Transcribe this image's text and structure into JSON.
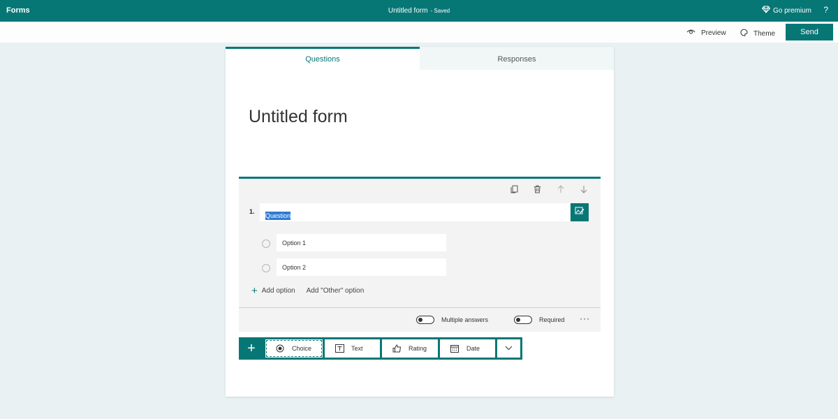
{
  "topbar": {
    "app_name": "Forms",
    "form_name": "Untitled form",
    "saved_status": "- Saved",
    "premium_label": "Go premium",
    "help_label": "?"
  },
  "commandbar": {
    "preview_label": "Preview",
    "theme_label": "Theme",
    "send_label": "Send"
  },
  "tabs": [
    {
      "label": "Questions",
      "active": true
    },
    {
      "label": "Responses",
      "active": false
    }
  ],
  "form": {
    "title": "Untitled form"
  },
  "question": {
    "number": "1.",
    "text": "Question",
    "options": [
      {
        "value": "Option 1"
      },
      {
        "value": "Option 2"
      }
    ],
    "add_option_label": "Add option",
    "add_other_label": "Add \"Other\" option",
    "multiple_answers_label": "Multiple answers",
    "multiple_answers_on": false,
    "required_label": "Required",
    "required_on": false,
    "more_label": "···"
  },
  "question_types": {
    "add_label": "+",
    "items": [
      {
        "label": "Choice",
        "icon": "radio-icon"
      },
      {
        "label": "Text",
        "icon": "text-icon"
      },
      {
        "label": "Rating",
        "icon": "thumbs-up-icon"
      },
      {
        "label": "Date",
        "icon": "calendar-icon"
      }
    ]
  },
  "colors": {
    "accent": "#077776",
    "page_bg": "#e9f1f3",
    "selection": "#2d7bd4"
  }
}
